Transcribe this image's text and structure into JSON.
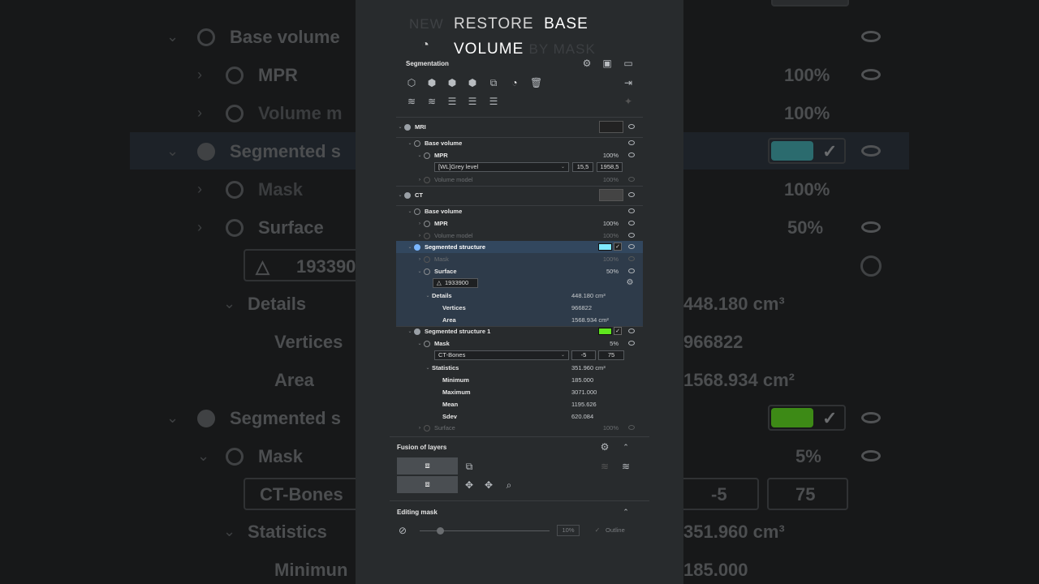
{
  "background": {
    "rows": [
      {
        "label": "Base volume",
        "pct": ""
      },
      {
        "label": "MPR",
        "pct": "100%"
      },
      {
        "label": "Volume m",
        "pct": "100%"
      },
      {
        "label": "Segmented s",
        "pct": ""
      },
      {
        "label": "Mask",
        "pct": "100%"
      },
      {
        "label": "Surface",
        "pct": "50%"
      },
      {
        "label": "193390",
        "pct": ""
      },
      {
        "label": "Details",
        "pct": "448.180 cm³"
      },
      {
        "label": "Vertices",
        "pct": "966822"
      },
      {
        "label": "Area",
        "pct": "1568.934 cm²"
      },
      {
        "label": "Segmented s",
        "pct": ""
      },
      {
        "label": "Mask",
        "pct": "5%"
      },
      {
        "label": "CT-Bones",
        "pct": ""
      },
      {
        "label": "Statistics",
        "pct": "351.960 cm³"
      },
      {
        "label": "Minimun",
        "pct": "185.000"
      }
    ],
    "ct_bones_min": "-5",
    "ct_bones_max": "75"
  },
  "overlay": {
    "line1_a": "RESTORE",
    "line1_b": "BASE",
    "line2_a": "VOLUME",
    "line2_b": "BY MASK",
    "faint_left": "NEW"
  },
  "segmentation": {
    "title": "Segmentation"
  },
  "tree": {
    "mri": {
      "label": "MRI"
    },
    "mri_base": {
      "label": "Base volume"
    },
    "mri_mpr": {
      "label": "MPR",
      "pct": "100%"
    },
    "mri_lut": {
      "value": "[WL]Grey level",
      "min": "15,5",
      "max": "1958,5"
    },
    "mri_volmodel": {
      "label": "Volume model",
      "pct": "100%"
    },
    "ct": {
      "label": "CT"
    },
    "ct_base": {
      "label": "Base volume"
    },
    "ct_mpr": {
      "label": "MPR",
      "pct": "100%"
    },
    "ct_volmodel": {
      "label": "Volume model",
      "pct": "100%"
    },
    "seg": {
      "label": "Segmented structure",
      "color": "#7fe8ff"
    },
    "seg_mask": {
      "label": "Mask",
      "pct": "100%"
    },
    "seg_surface": {
      "label": "Surface",
      "pct": "50%"
    },
    "seg_triangles": "1933900",
    "seg_details": {
      "label": "Details",
      "value": "448.180 cm³"
    },
    "seg_vertices": {
      "label": "Vertices",
      "value": "966822"
    },
    "seg_area": {
      "label": "Area",
      "value": "1568.934 cm²"
    },
    "seg1": {
      "label": "Segmented structure 1",
      "color": "#5fe61e"
    },
    "seg1_mask": {
      "label": "Mask",
      "pct": "5%"
    },
    "seg1_lut": {
      "value": "CT-Bones",
      "min": "-5",
      "max": "75"
    },
    "seg1_stats": {
      "label": "Statistics",
      "value": "351.960 cm³"
    },
    "seg1_min": {
      "label": "Minimum",
      "value": "185.000"
    },
    "seg1_max": {
      "label": "Maximum",
      "value": "3071.000"
    },
    "seg1_mean": {
      "label": "Mean",
      "value": "1195.626"
    },
    "seg1_sdev": {
      "label": "Sdev",
      "value": "620.084"
    },
    "seg1_surface": {
      "label": "Surface",
      "pct": "100%"
    }
  },
  "fusion": {
    "title": "Fusion of layers"
  },
  "editing": {
    "title": "Editing mask",
    "opacity": "10%",
    "outline_label": "Outline"
  },
  "accent_colors": {
    "selection": "#32475e",
    "highlight": "#2e3b4a"
  }
}
